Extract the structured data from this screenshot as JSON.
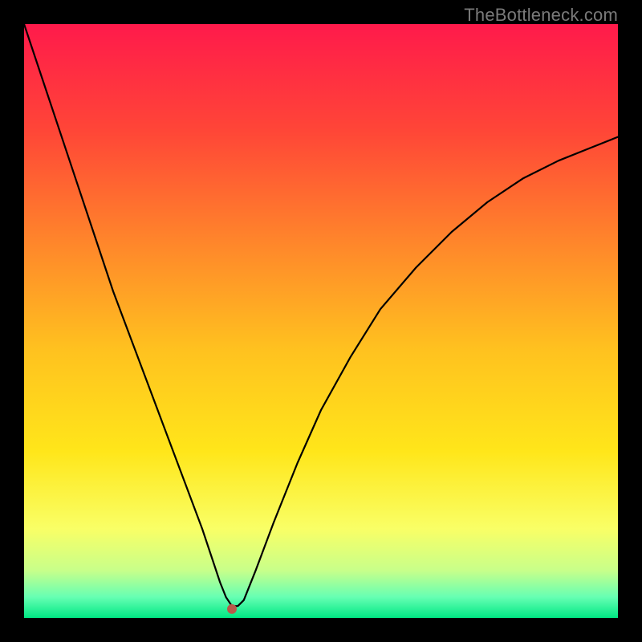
{
  "watermark": "TheBottleneck.com",
  "chart_data": {
    "type": "line",
    "title": "",
    "xlabel": "",
    "ylabel": "",
    "xlim": [
      0,
      100
    ],
    "ylim": [
      0,
      100
    ],
    "grid": false,
    "legend": false,
    "background_gradient_stops": [
      {
        "offset": 0.0,
        "color": "#ff1a4b"
      },
      {
        "offset": 0.18,
        "color": "#ff4637"
      },
      {
        "offset": 0.38,
        "color": "#ff8a2a"
      },
      {
        "offset": 0.55,
        "color": "#ffc21f"
      },
      {
        "offset": 0.72,
        "color": "#ffe61a"
      },
      {
        "offset": 0.85,
        "color": "#f9ff66"
      },
      {
        "offset": 0.92,
        "color": "#c8ff8a"
      },
      {
        "offset": 0.965,
        "color": "#66ffb3"
      },
      {
        "offset": 1.0,
        "color": "#00e884"
      }
    ],
    "optimum_marker": {
      "x": 35,
      "y": 1.5,
      "color": "#b85a4a",
      "radius": 6
    },
    "series": [
      {
        "name": "bottleneck-curve",
        "color": "#000000",
        "width": 2.2,
        "x": [
          0,
          3,
          6,
          9,
          12,
          15,
          18,
          21,
          24,
          27,
          30,
          32,
          33,
          34,
          35,
          36,
          37,
          39,
          42,
          46,
          50,
          55,
          60,
          66,
          72,
          78,
          84,
          90,
          95,
          100
        ],
        "values": [
          100,
          91,
          82,
          73,
          64,
          55,
          47,
          39,
          31,
          23,
          15,
          9,
          6,
          3.5,
          2,
          2,
          3,
          8,
          16,
          26,
          35,
          44,
          52,
          59,
          65,
          70,
          74,
          77,
          79,
          81
        ]
      }
    ]
  }
}
